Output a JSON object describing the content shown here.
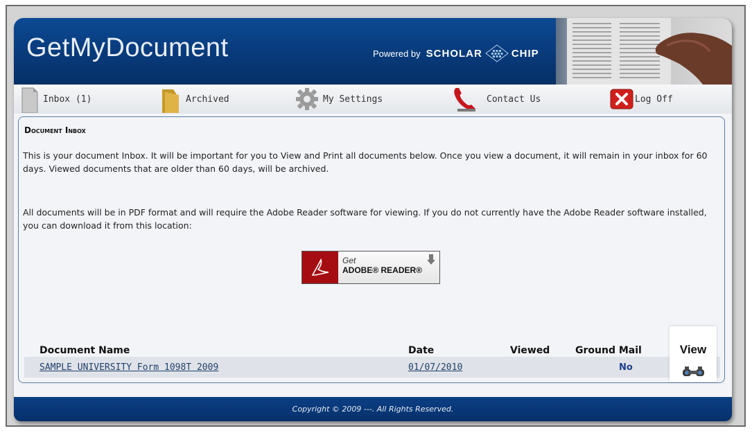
{
  "header": {
    "title": "GetMyDocument",
    "powered_by": "Powered by",
    "brand_left": "SCHOLAR",
    "brand_right": "CHIP"
  },
  "nav": [
    {
      "label": "Inbox (1)",
      "icon": "document-icon"
    },
    {
      "label": "Archived",
      "icon": "folder-icon"
    },
    {
      "label": "My Settings",
      "icon": "gear-icon"
    },
    {
      "label": "Contact Us",
      "icon": "phone-icon"
    },
    {
      "label": "Log Off",
      "icon": "close-icon"
    }
  ],
  "inbox": {
    "title": "Document Inbox",
    "para1": "This is your document Inbox. It will be important for you to View and Print all documents below. Once you view a document, it will remain in your inbox for 60 days. Viewed documents that are older than 60 days, will be archived.",
    "para2": "All documents will be in PDF format and will require the Adobe Reader software for viewing. If you do not currently have the Adobe Reader software installed, you can download it from this location:",
    "adobe_get": "Get",
    "adobe_name": "ADOBE® READER®"
  },
  "table": {
    "headers": {
      "name": "Document Name",
      "date": "Date",
      "viewed": "Viewed",
      "mail": "Ground Mail",
      "view": "View"
    },
    "rows": [
      {
        "name": "SAMPLE UNIVERSITY Form 1098T 2009",
        "date": "01/07/2010",
        "viewed": "",
        "mail": "No"
      }
    ]
  },
  "footer": {
    "copyright": "Copyright © 2009 ---. All Rights Reserved."
  },
  "colors": {
    "header_blue": "#0a4388",
    "footer_blue": "#07336f",
    "link": "#22406a",
    "adobe_red": "#a50d12"
  }
}
